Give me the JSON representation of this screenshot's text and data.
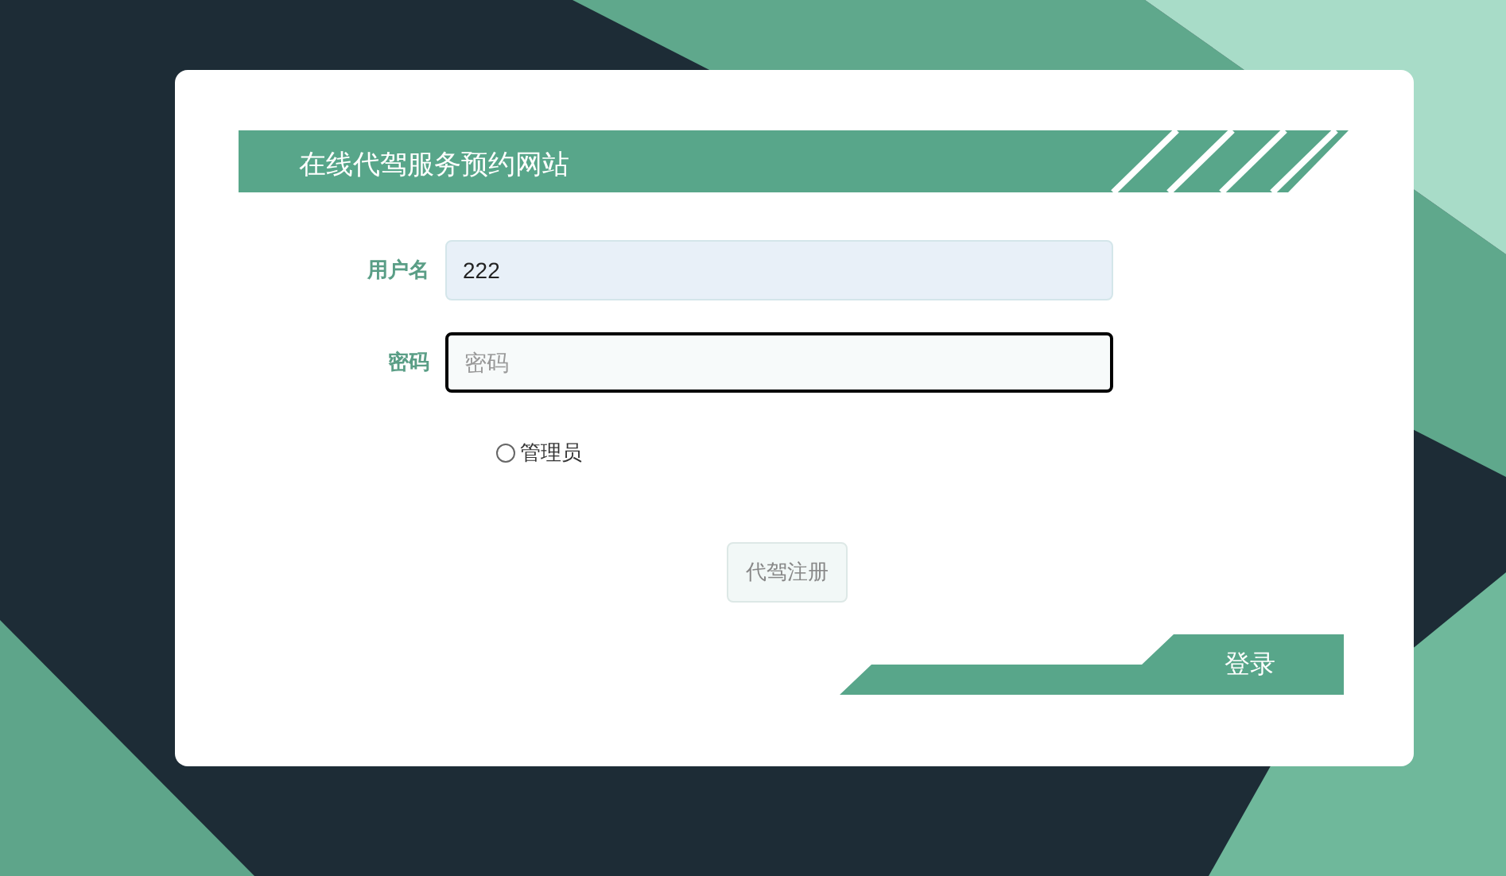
{
  "header": {
    "title": "在线代驾服务预约网站"
  },
  "fields": [
    {
      "label": "用户名",
      "value": "222",
      "focused": false
    },
    {
      "label": "密码",
      "placeholder": "密码",
      "focused": true
    }
  ],
  "roles": [
    {
      "label": "管理员",
      "selected": false
    }
  ],
  "buttons": {
    "register": "代驾注册",
    "login": "登录"
  }
}
